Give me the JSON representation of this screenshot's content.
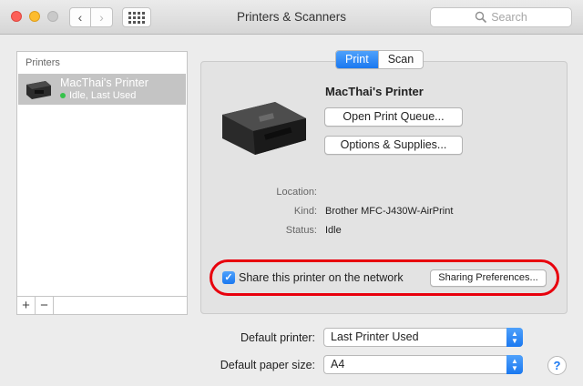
{
  "window": {
    "title": "Printers & Scanners"
  },
  "toolbar": {
    "back_icon": "chevron-left-icon",
    "forward_icon": "chevron-right-icon",
    "grid_icon": "show-all-grid-icon",
    "search_placeholder": "Search"
  },
  "printer_list": {
    "header": "Printers",
    "items": [
      {
        "name": "MacThai's Printer",
        "status": "Idle, Last Used",
        "status_color": "#36c24b"
      }
    ],
    "add_label": "+",
    "remove_label": "−"
  },
  "tabs": {
    "print": "Print",
    "scan": "Scan",
    "active": "print"
  },
  "detail": {
    "printer_name": "MacThai's Printer",
    "open_queue_label": "Open Print Queue...",
    "options_label": "Options & Supplies...",
    "location_label": "Location:",
    "location_value": "",
    "kind_label": "Kind:",
    "kind_value": "Brother MFC-J430W-AirPrint",
    "status_label": "Status:",
    "status_value": "Idle"
  },
  "sharing": {
    "checkbox_checked": true,
    "label": "Share this printer on the network",
    "prefs_label": "Sharing Preferences...",
    "highlight_color": "#e8000d"
  },
  "defaults": {
    "printer_label": "Default printer:",
    "printer_value": "Last Printer Used",
    "paper_label": "Default paper size:",
    "paper_value": "A4"
  },
  "help_label": "?",
  "colors": {
    "accent": "#1a78f0",
    "selection": "#c4c4c4"
  }
}
